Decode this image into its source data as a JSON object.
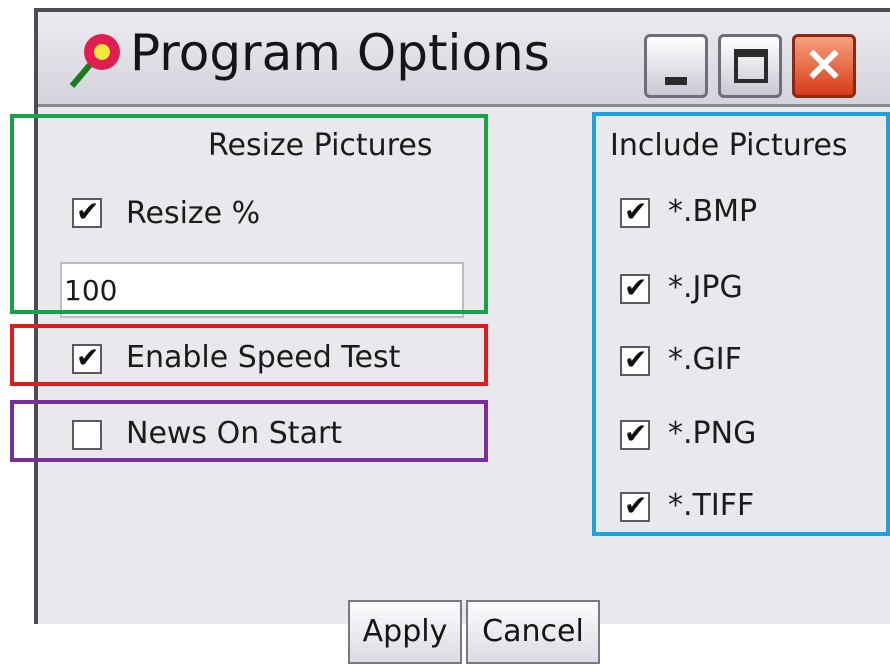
{
  "window": {
    "title": "Program Options"
  },
  "resize": {
    "heading": "Resize Pictures",
    "checkbox_label": "Resize %",
    "checked": true,
    "value": "100"
  },
  "speed_test": {
    "label": "Enable Speed Test",
    "checked": true
  },
  "news": {
    "label": "News On Start",
    "checked": false
  },
  "include": {
    "heading": "Include Pictures",
    "items": [
      {
        "label": "*.BMP",
        "checked": true
      },
      {
        "label": "*.JPG",
        "checked": true
      },
      {
        "label": "*.GIF",
        "checked": true
      },
      {
        "label": "*.PNG",
        "checked": true
      },
      {
        "label": "*.TIFF",
        "checked": true
      }
    ]
  },
  "buttons": {
    "apply": "Apply",
    "cancel": "Cancel"
  },
  "annotation_colors": {
    "resize": "#17a14a",
    "speed_test": "#e11b1b",
    "news": "#7a2d9c",
    "include": "#1aa3e0"
  }
}
